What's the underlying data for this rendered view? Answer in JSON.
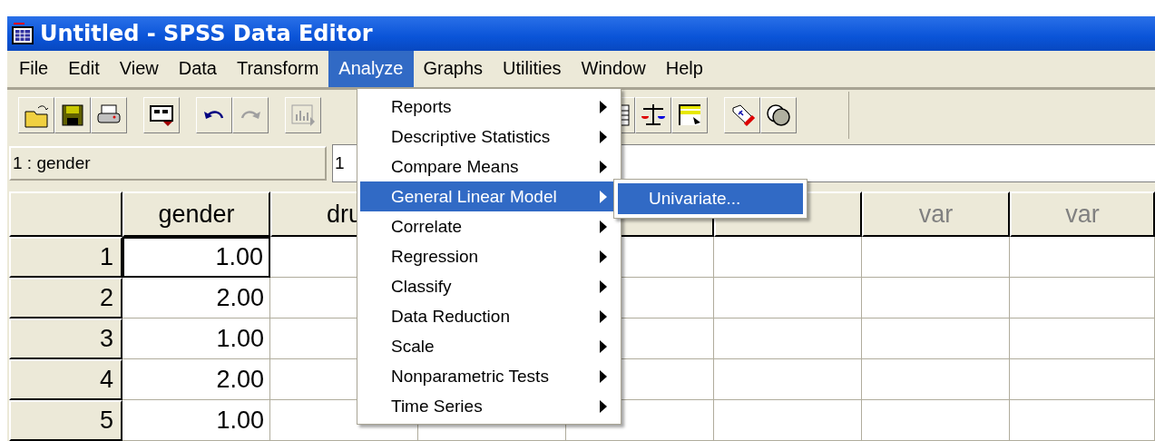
{
  "window": {
    "title": "Untitled - SPSS Data Editor"
  },
  "menu_bar": [
    {
      "label": "File",
      "selected": false
    },
    {
      "label": "Edit",
      "selected": false
    },
    {
      "label": "View",
      "selected": false
    },
    {
      "label": "Data",
      "selected": false
    },
    {
      "label": "Transform",
      "selected": false
    },
    {
      "label": "Analyze",
      "selected": true
    },
    {
      "label": "Graphs",
      "selected": false
    },
    {
      "label": "Utilities",
      "selected": false
    },
    {
      "label": "Window",
      "selected": false
    },
    {
      "label": "Help",
      "selected": false
    }
  ],
  "toolbar": [
    [
      {
        "kind": "open"
      },
      {
        "kind": "save"
      },
      {
        "kind": "print"
      }
    ],
    [
      {
        "kind": "recall"
      }
    ],
    [
      {
        "kind": "undo"
      },
      {
        "kind": "redo",
        "disabled": true
      }
    ],
    [
      {
        "kind": "chart",
        "disabled": true
      }
    ],
    [
      {
        "kind": "grid"
      },
      {
        "kind": "scale"
      },
      {
        "kind": "table"
      }
    ],
    [
      {
        "kind": "tag"
      },
      {
        "kind": "circles"
      }
    ]
  ],
  "cell_editor": {
    "cell": "1 : gender",
    "value": "1"
  },
  "grid": {
    "columns": [
      "gender",
      "dru"
    ],
    "var_columns": [
      "var",
      "var"
    ],
    "rows": [
      {
        "label": "1",
        "values": [
          {
            "text": "1.00",
            "selected": true
          }
        ]
      },
      {
        "label": "2",
        "values": [
          {
            "text": "2.00",
            "selected": false
          }
        ]
      },
      {
        "label": "3",
        "values": [
          {
            "text": "1.00",
            "selected": false
          }
        ]
      },
      {
        "label": "4",
        "values": [
          {
            "text": "2.00",
            "selected": false
          }
        ]
      },
      {
        "label": "5",
        "values": [
          {
            "text": "1.00",
            "selected": false
          }
        ]
      }
    ]
  },
  "analyze_menu": {
    "items": [
      {
        "label": "Reports",
        "has_submenu": true,
        "selected": false
      },
      {
        "label": "Descriptive Statistics",
        "has_submenu": true,
        "selected": false
      },
      {
        "label": "Compare Means",
        "has_submenu": true,
        "selected": false
      },
      {
        "label": "General Linear Model",
        "has_submenu": true,
        "selected": true
      },
      {
        "label": "Correlate",
        "has_submenu": true,
        "selected": false
      },
      {
        "label": "Regression",
        "has_submenu": true,
        "selected": false
      },
      {
        "label": "Classify",
        "has_submenu": true,
        "selected": false
      },
      {
        "label": "Data Reduction",
        "has_submenu": true,
        "selected": false
      },
      {
        "label": "Scale",
        "has_submenu": true,
        "selected": false
      },
      {
        "label": "Nonparametric Tests",
        "has_submenu": true,
        "selected": false
      },
      {
        "label": "Time Series",
        "has_submenu": true,
        "selected": false
      }
    ]
  },
  "submenu": {
    "items": [
      {
        "label": "Univariate...",
        "selected": true
      }
    ]
  }
}
